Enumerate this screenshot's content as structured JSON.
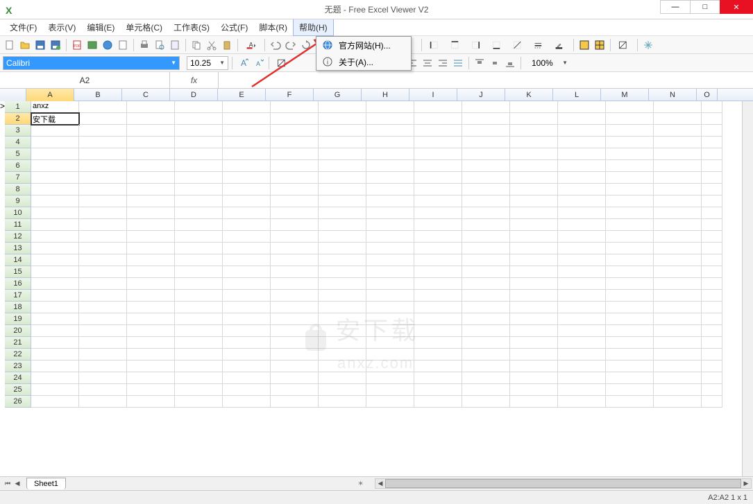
{
  "title": "无题 - Free Excel Viewer V2",
  "menu": {
    "file": "文件(F)",
    "view": "表示(V)",
    "edit": "编辑(E)",
    "cell": "单元格(C)",
    "sheet": "工作表(S)",
    "formula": "公式(F)",
    "script": "脚本(R)",
    "help": "帮助(H)"
  },
  "help_menu": {
    "website": "官方网站(H)...",
    "about": "关于(A)..."
  },
  "font": {
    "name": "Calibri",
    "size": "10.25"
  },
  "zoom": "100%",
  "name_box": "A2",
  "fx_label": "fx",
  "columns": [
    "A",
    "B",
    "C",
    "D",
    "E",
    "F",
    "G",
    "H",
    "I",
    "J",
    "K",
    "L",
    "M",
    "N",
    "O"
  ],
  "rows_count": 26,
  "cells": {
    "A1": "anxz",
    "A2": "安下载"
  },
  "selected_cell": "A2",
  "sheet_tab": "Sheet1",
  "status": "A2:A2 1 x 1",
  "watermark": {
    "main": "安下载",
    "sub": "anxz.com"
  }
}
